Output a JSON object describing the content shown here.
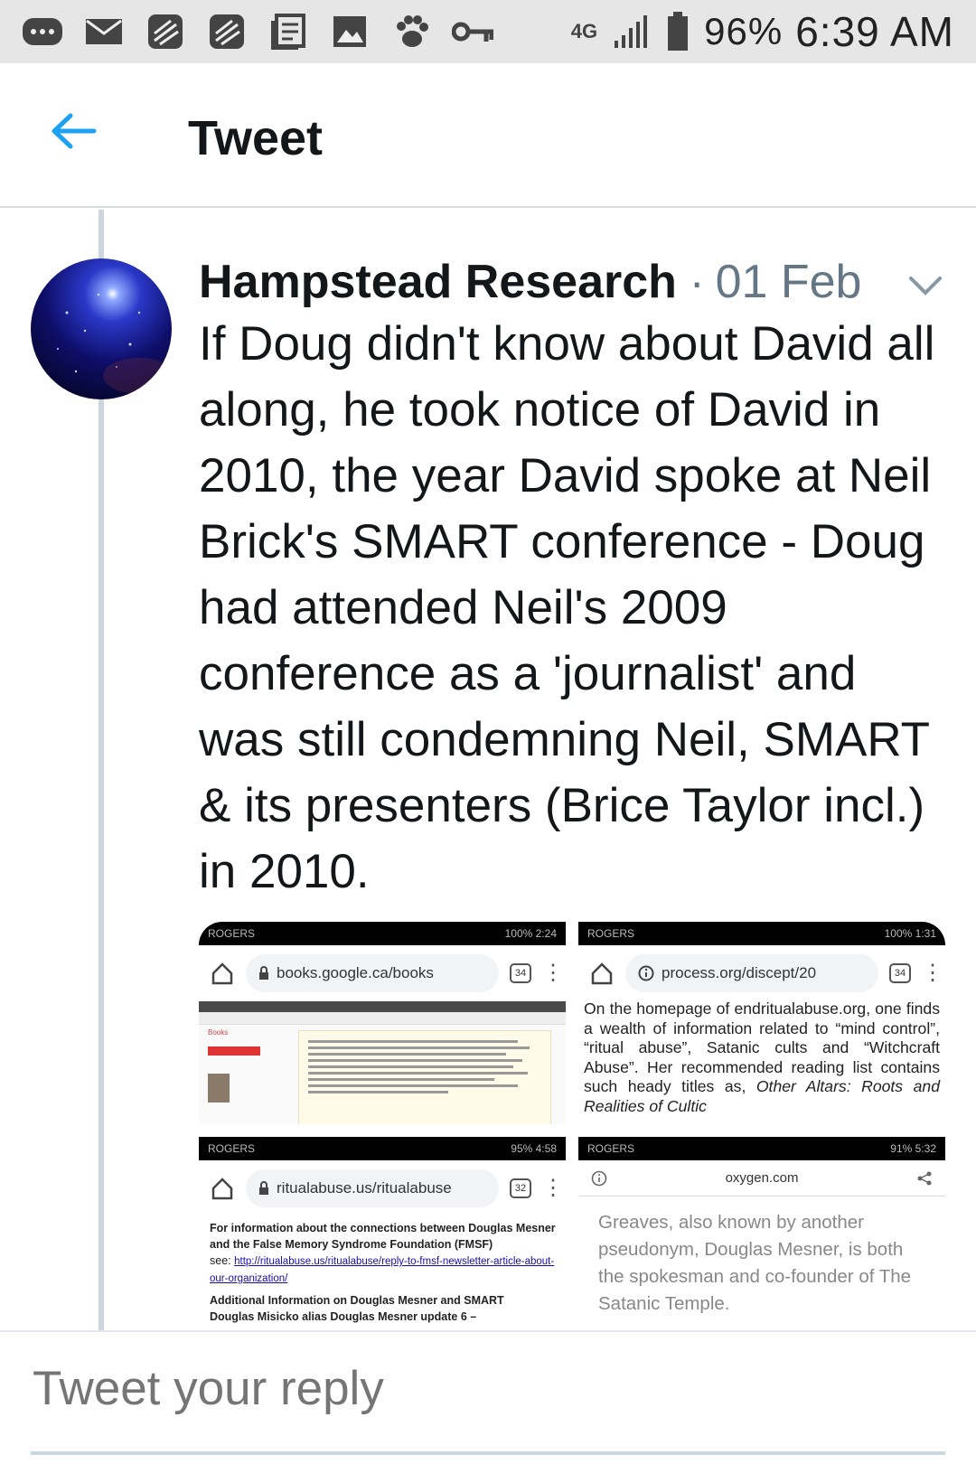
{
  "status_bar": {
    "network": "4G",
    "battery": "96%",
    "time": "6:39 AM",
    "icons": [
      "more-icon",
      "mail-icon",
      "blackberry-icon",
      "blackberry-icon",
      "news-icon",
      "gallery-icon",
      "paw-icon",
      "key-icon"
    ]
  },
  "app_bar": {
    "title": "Tweet"
  },
  "tweet": {
    "author": "Hampstead Research",
    "separator": "·",
    "date": "01 Feb",
    "text": "If Doug didn't know about David all along, he took notice of David in 2010, the year David spoke at Neil Brick's SMART conference - Doug had attended Neil's 2009 conference as a 'journalist' and was still condemning Neil, SMART & its presenters (Brice Taylor incl.) in 2010."
  },
  "media": {
    "tile1": {
      "carrier": "ROGERS",
      "status": "100% 2:24",
      "url": "books.google.ca/books",
      "tabs": "34",
      "side_label": "Books"
    },
    "tile2": {
      "carrier": "ROGERS",
      "status": "100% 1:31",
      "url": "process.org/discept/20",
      "tabs": "34",
      "text_a": "On the homepage of endritualabuse.org, one finds a wealth of information related to “mind control”, “ritual abuse”, Satanic cults and “Witchcraft Abuse”. Her recommended reading list contains such heady titles as, ",
      "text_b": "Other Altars: Roots and Realities of Cultic"
    },
    "tile3": {
      "carrier": "ROGERS",
      "status": "95% 4:58",
      "url": "ritualabuse.us/ritualabuse",
      "tabs": "32",
      "line1": "For information about the connections between Douglas Mesner and the False Memory Syndrome Foundation (FMSF)",
      "see": "see: ",
      "link": "http://ritualabuse.us/ritualabuse/reply-to-fmsf-newsletter-article-about-our-organization/",
      "line2": "Additional Information on Douglas Mesner and SMART",
      "line3": "Douglas Misicko alias Douglas Mesner update 6 –"
    },
    "tile4": {
      "carrier": "ROGERS",
      "status": "91% 5:32",
      "url": "oxygen.com",
      "text": "Greaves, also known by another pseudonym, Douglas Mesner, is both the spokesman and co-founder of The Satanic Temple."
    }
  },
  "reply": {
    "placeholder": "Tweet your reply"
  },
  "colors": {
    "accent": "#1da1f2",
    "secondary_text": "#657786",
    "divider": "#ccd6dd"
  }
}
